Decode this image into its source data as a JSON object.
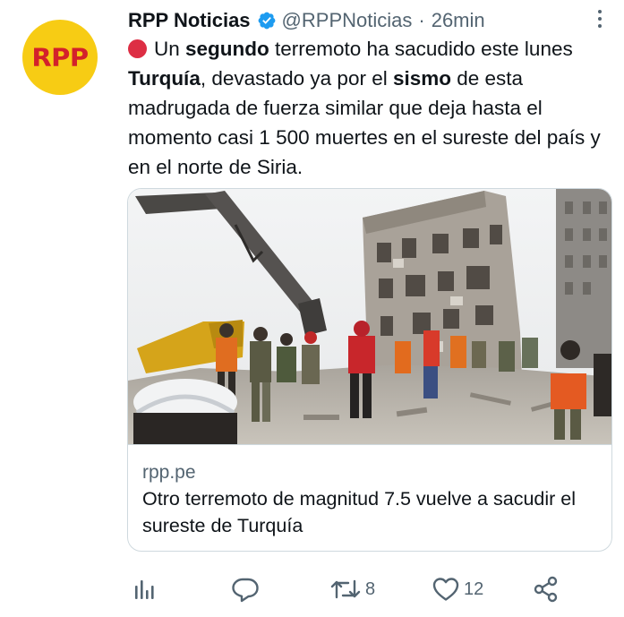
{
  "avatar": {
    "text": "RPP",
    "bg": "#f7cc14",
    "fg": "#d3212b"
  },
  "tweet": {
    "author_name": "RPP Noticias",
    "verified_icon": "verified-badge-icon",
    "handle": "@RPPNoticias",
    "separator": "·",
    "time": "26min",
    "text_parts": {
      "p1": "Un ",
      "b1": "segundo",
      "p2": " terremoto ha sacudido este lunes ",
      "b2": "Turquía",
      "p3": ", devastado ya por el ",
      "b3": "sismo",
      "p4": " de esta madrugada de fuerza similar que deja hasta el momento casi 1 500 muertes en el sureste del país y en el norte de Siria."
    }
  },
  "card": {
    "image_icon": "earthquake-rubble-photo",
    "domain": "rpp.pe",
    "title": "Otro terremoto de magnitud 7.5 vuelve a sacudir el sureste de Turquía"
  },
  "actions": {
    "analytics_icon": "analytics-icon",
    "reply_icon": "reply-icon",
    "retweet_icon": "retweet-icon",
    "retweet_count": "8",
    "like_icon": "heart-icon",
    "like_count": "12",
    "share_icon": "share-icon"
  },
  "colors": {
    "text": "#0f1419",
    "secondary": "#536471",
    "verified": "#1d9bf0",
    "border": "#cfd9de",
    "red_circle": "#dd2e44"
  }
}
